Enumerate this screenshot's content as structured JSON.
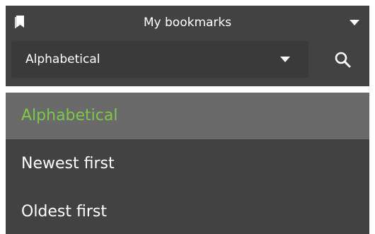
{
  "header": {
    "title": "My bookmarks",
    "bookmark_icon": "bookmark-icon",
    "chevron_icon": "chevron-down-icon"
  },
  "sort": {
    "selected": "Alphabetical",
    "chevron_icon": "chevron-down-icon"
  },
  "search": {
    "icon": "search-icon"
  },
  "dropdown": {
    "options": [
      {
        "label": "Alphabetical",
        "selected": true
      },
      {
        "label": "Newest first",
        "selected": false
      },
      {
        "label": "Oldest first",
        "selected": false
      }
    ]
  },
  "colors": {
    "panel_background": "#424242",
    "selected_background": "#6a6a6a",
    "selected_text": "#7cc94a",
    "text": "#ffffff"
  }
}
